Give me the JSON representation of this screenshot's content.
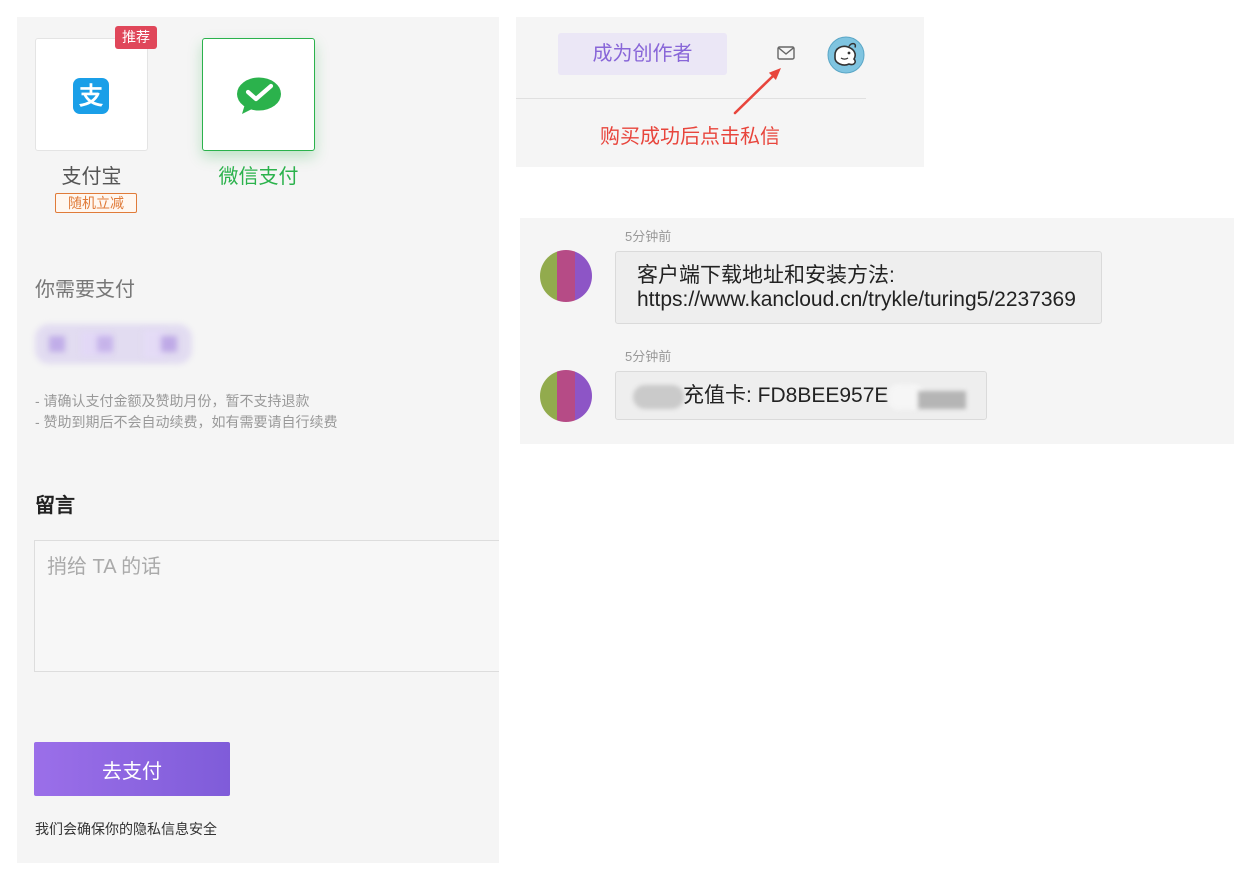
{
  "payment_panel": {
    "methods": [
      {
        "name": "支付宝",
        "badge": "推荐",
        "promo": "随机立减",
        "logo_glyph": "支",
        "icon": "alipay-icon",
        "selected": false
      },
      {
        "name": "微信支付",
        "icon": "wechat-pay-icon",
        "selected": true
      }
    ],
    "amount_label": "你需要支付",
    "notes": [
      "- 请确认支付金额及赞助月份，暂不支持退款",
      "- 赞助到期后不会自动续费，如有需要请自行续费"
    ],
    "message_title": "留言",
    "message_placeholder": "捎给 TA 的话",
    "pay_button_label": "去支付",
    "privacy_note": "我们会确保你的隐私信息安全"
  },
  "header_panel": {
    "become_creator_label": "成为创作者",
    "mail_icon": "mail-icon",
    "avatar_icon": "user-avatar-icon",
    "annotation_arrow_icon": "arrow-up-right-icon",
    "annotation_text": "购买成功后点击私信"
  },
  "chat_panel": {
    "messages": [
      {
        "time": "5分钟前",
        "lines": [
          "客户端下载地址和安装方法:",
          "https://www.kancloud.cn/trykle/turing5/2237369"
        ]
      },
      {
        "time": "5分钟前",
        "text": "充值卡: FD8BEE957E"
      }
    ]
  },
  "colors": {
    "panel_bg": "#f5f5f5",
    "accent_purple": "#7f5cd9",
    "wechat_green": "#2bb24c",
    "alipay_blue": "#1a9fe8",
    "badge_red": "#e0475a",
    "promo_orange": "#e07b39",
    "annotation_red": "#e8453c",
    "creator_button_bg": "#ebe7f6",
    "creator_button_text": "#8866d8"
  }
}
